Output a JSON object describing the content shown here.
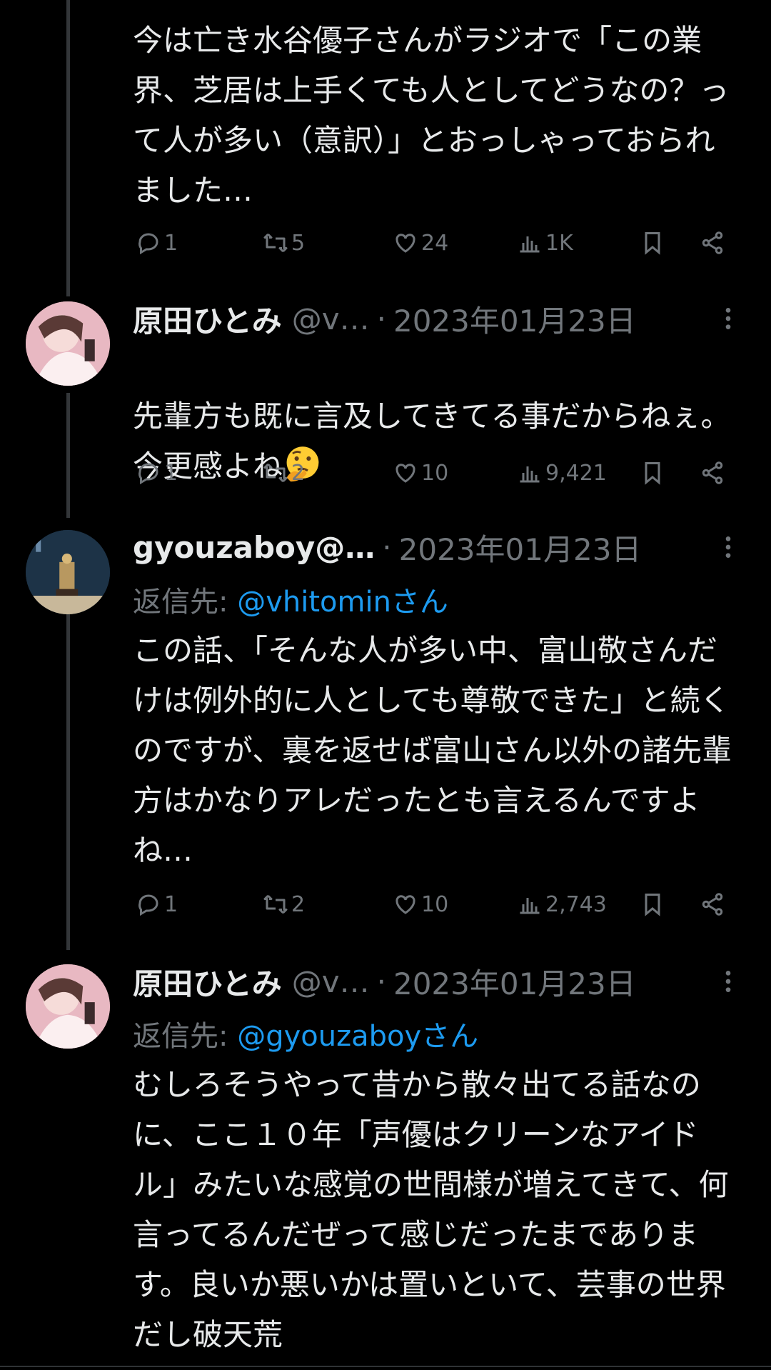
{
  "tweets": [
    {
      "body": "今は亡き水谷優子さんがラジオで「この業界、芝居は上手くても人としてどうなの？って人が多い（意訳）」とおっしゃっておられました…",
      "stats": {
        "replies": "1",
        "retweets": "5",
        "likes": "24",
        "views": "1K"
      }
    },
    {
      "name": "原田ひとみ",
      "handle": "@v…",
      "date": "2023年01月23日",
      "body": "先輩方も既に言及してきてる事だからねぇ。今更感よね",
      "emoji_icon": "thinking-face-emoji",
      "stats": {
        "replies": "1",
        "retweets": "2",
        "likes": "10",
        "views": "9,421"
      }
    },
    {
      "name": "gyouzaboy@…",
      "date": "2023年01月23日",
      "reply_prefix": "返信先: ",
      "reply_mention": "@vhitominさん",
      "body": "この話、「そんな人が多い中、富山敬さんだけは例外的に人としても尊敬できた」と続くのですが、裏を返せば富山さん以外の諸先輩方はかなりアレだったとも言えるんですよね…",
      "stats": {
        "replies": "1",
        "retweets": "2",
        "likes": "10",
        "views": "2,743"
      }
    },
    {
      "name": "原田ひとみ",
      "handle": "@v…",
      "date": "2023年01月23日",
      "reply_prefix": "返信先: ",
      "reply_mention": "@gyouzaboyさん",
      "body": "むしろそうやって昔から散々出てる話なのに、ここ１０年「声優はクリーンなアイドル」みたいな感覚の世間様が増えてきて、何言ってるんだぜって感じだったまであります。良いか悪いかは置いといて、芸事の世界だし破天荒"
    }
  ],
  "separator": "·",
  "icons": [
    "reply-icon",
    "retweet-icon",
    "like-icon",
    "views-icon",
    "bookmark-icon",
    "share-icon",
    "more-icon"
  ],
  "colors": {
    "background": "#000000",
    "text": "#e7e9ea",
    "muted": "#71767b",
    "link": "#1d9bf0"
  }
}
